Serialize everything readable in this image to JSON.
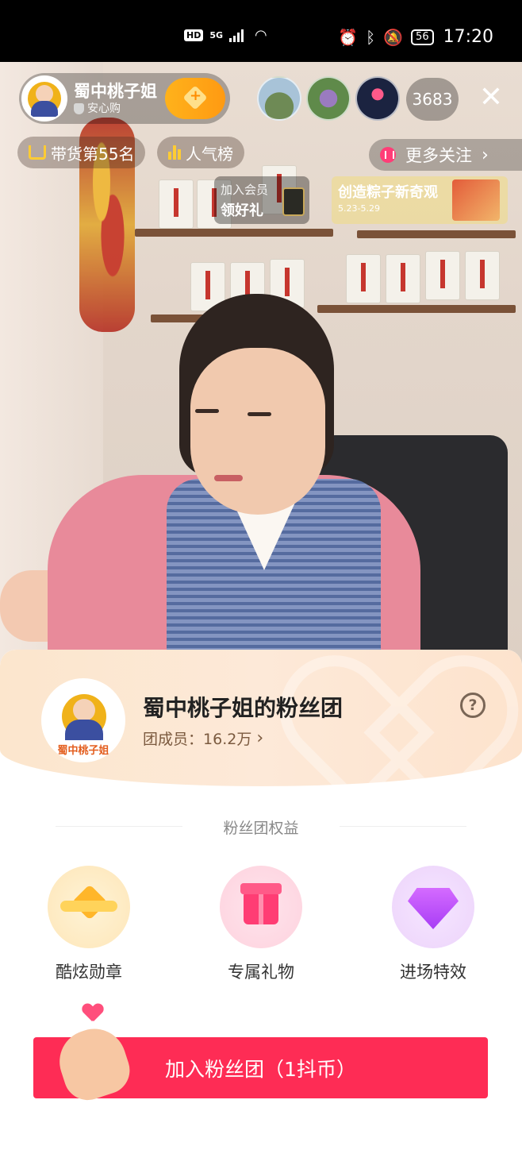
{
  "status_bar": {
    "network_badge": "HD",
    "network_type": "5G",
    "battery": "56",
    "time": "17:20",
    "icons": [
      "signal-icon",
      "wifi-icon",
      "alarm-icon",
      "bluetooth-icon",
      "mute-icon",
      "battery-icon"
    ]
  },
  "live": {
    "host": {
      "name": "蜀中桃子姐",
      "badge": "安心购",
      "follow_icon": "heart-plus-icon"
    },
    "viewer_count": "3683",
    "close_icon": "close-icon",
    "tags": {
      "rank": "带货第55名",
      "popularity": "人气榜"
    },
    "more_follow": "更多关注",
    "member_banner": {
      "line1": "加入会员",
      "line2": "领好礼"
    },
    "promo_banner": {
      "title": "创造粽子新奇观",
      "dates": "5.23-5.29"
    }
  },
  "fan_club": {
    "avatar_label": "蜀中桃子姐",
    "title": "蜀中桃子姐的粉丝团",
    "members_label": "团成员：",
    "members_value": "16.2万",
    "help_icon": "?",
    "section_title": "粉丝团权益",
    "benefits": [
      {
        "label": "酷炫勋章",
        "icon": "medal-icon"
      },
      {
        "label": "专属礼物",
        "icon": "gift-icon"
      },
      {
        "label": "进场特效",
        "icon": "diamond-icon"
      }
    ],
    "join_button": "加入粉丝团（1抖币）",
    "colors": {
      "primary": "#fe2c55",
      "accent": "#ffb21b"
    }
  }
}
